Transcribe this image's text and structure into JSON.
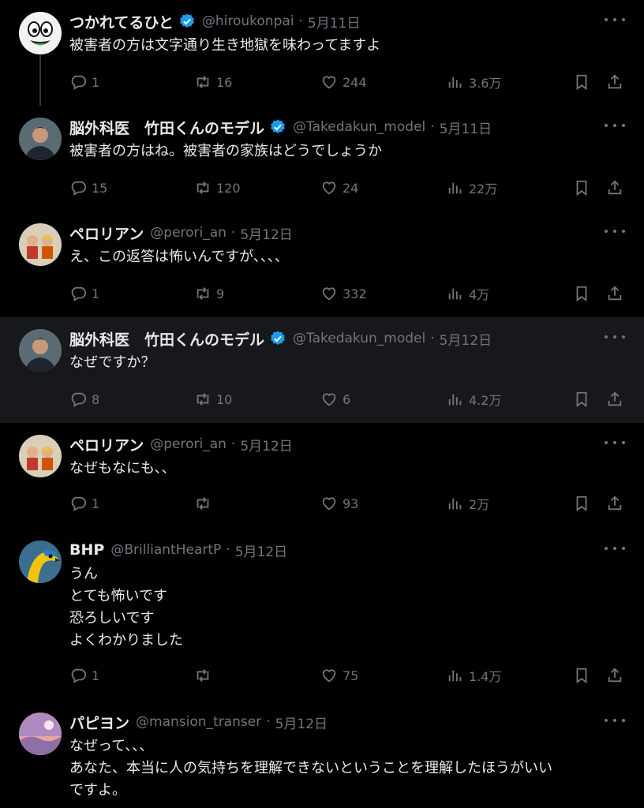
{
  "colors": {
    "background": "#000000",
    "highlight": "#16181c",
    "muted": "#71767b",
    "verified": "#1d9bf0"
  },
  "icons": {
    "reply": "reply-icon",
    "retweet": "retweet-icon",
    "like": "heart-icon",
    "views": "views-icon",
    "bookmark": "bookmark-icon",
    "share": "share-icon",
    "more": "more-icon",
    "verified": "verified-badge-icon"
  },
  "tweets": [
    {
      "name": "つかれてるひと",
      "verified": true,
      "handle": "@hiroukonpai",
      "date": "5月11日",
      "text": "被害者の方は文字通り生き地獄を味わってますよ",
      "replies": "1",
      "retweets": "16",
      "likes": "244",
      "views": "3.6万"
    },
    {
      "name": "脳外科医　竹田くんのモデル",
      "verified": true,
      "handle": "@Takedakun_model",
      "date": "5月11日",
      "text": "被害者の方はね。被害者の家族はどうでしょうか",
      "replies": "15",
      "retweets": "120",
      "likes": "24",
      "views": "22万"
    },
    {
      "name": "ペロリアン",
      "verified": false,
      "handle": "@perori_an",
      "date": "5月12日",
      "text": "え、この返答は怖いんですが、、、、",
      "replies": "1",
      "retweets": "9",
      "likes": "332",
      "views": "4万"
    },
    {
      "name": "脳外科医　竹田くんのモデル",
      "verified": true,
      "handle": "@Takedakun_model",
      "date": "5月12日",
      "text": "なぜですか？",
      "replies": "8",
      "retweets": "10",
      "likes": "6",
      "views": "4.2万"
    },
    {
      "name": "ペロリアン",
      "verified": false,
      "handle": "@perori_an",
      "date": "5月12日",
      "text": "なぜもなにも、、",
      "replies": "1",
      "retweets": "",
      "likes": "93",
      "views": "2万"
    },
    {
      "name": "BHP",
      "verified": false,
      "handle": "@BrilliantHeartP",
      "date": "5月12日",
      "text": "うん\nとても怖いです\n恐ろしいです\nよくわかりました",
      "replies": "1",
      "retweets": "",
      "likes": "75",
      "views": "1.4万"
    },
    {
      "name": "パピヨン",
      "verified": false,
      "handle": "@mansion_transer",
      "date": "5月12日",
      "text": "なぜって、、、\nあなた、本当に人の気持ちを理解できないということを理解したほうがいい\nですよ。",
      "replies": "",
      "retweets": "",
      "likes": "",
      "views": ""
    }
  ]
}
